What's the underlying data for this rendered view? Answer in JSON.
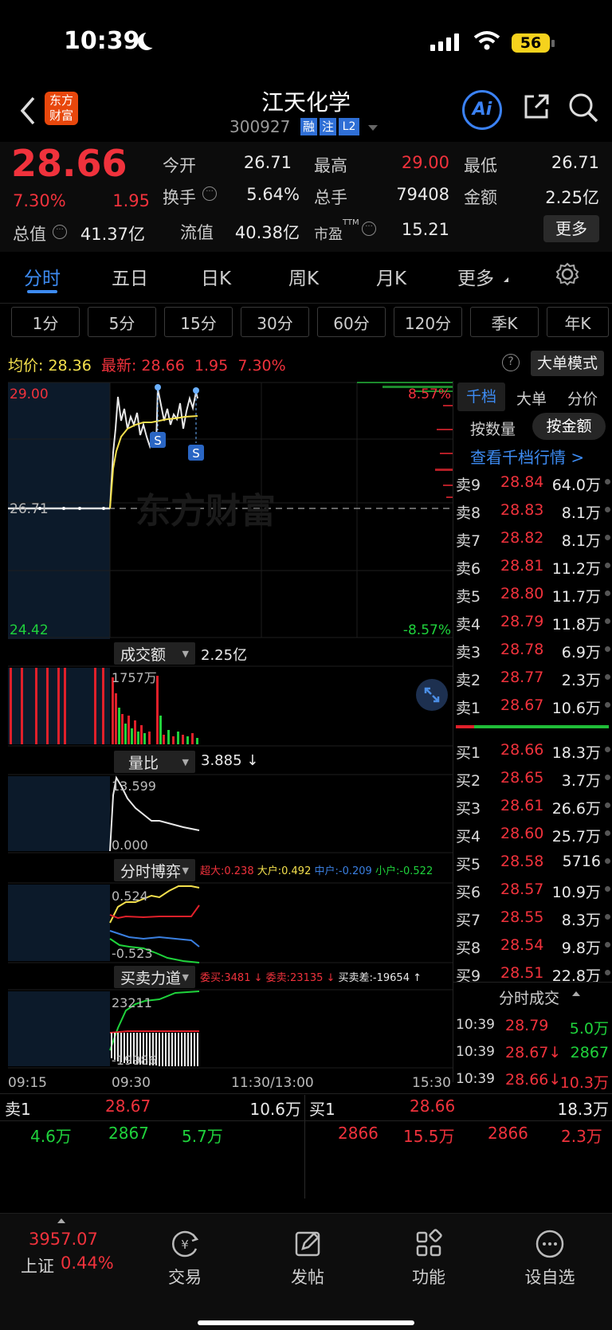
{
  "status": {
    "time": "10:39",
    "battery": "56"
  },
  "header": {
    "logo_top": "东方",
    "logo_bottom": "财富",
    "title": "江天化学",
    "code": "300927",
    "tag_margin": "融",
    "tag_note": "注",
    "tag_l2": "L2",
    "ai": "Ai"
  },
  "quote": {
    "price": "28.66",
    "pct": "7.30%",
    "chg": "1.95",
    "open_label": "今开",
    "open": "26.71",
    "high_label": "最高",
    "high": "29.00",
    "low_label": "最低",
    "low": "26.71",
    "turnover_label": "换手",
    "turnover": "5.64%",
    "vol_label": "总手",
    "vol": "79408",
    "amount_label": "金额",
    "amount": "2.25亿",
    "mcap_label": "总值",
    "mcap": "41.37亿",
    "float_label": "流值",
    "float": "40.38亿",
    "pe_label": "市盈",
    "pe_sup": "TTM",
    "pe": "15.21",
    "more": "更多"
  },
  "tabs": [
    "分时",
    "五日",
    "日K",
    "周K",
    "月K",
    "更多"
  ],
  "periods": [
    "1分",
    "5分",
    "15分",
    "30分",
    "60分",
    "120分",
    "季K",
    "年K"
  ],
  "info": {
    "avg_label": "均价:",
    "avg": "28.36",
    "latest_label": "最新:",
    "latest": "28.66",
    "chg": "1.95",
    "pct": "7.30%",
    "big_mode": "大单模式"
  },
  "chart": {
    "y_top": "29.00",
    "y_mid": "26.71",
    "y_bottom": "24.42",
    "pct_top": "8.57%",
    "pct_bottom": "-8.57%",
    "watermark": "东方财富",
    "signal": "S",
    "amount_label": "成交额",
    "amount_val": "2.25亿",
    "amount_max": "1757万",
    "ratio_label": "量比",
    "ratio_val": "3.885 ↓",
    "ratio_max": "13.599",
    "ratio_min": "0.000",
    "game_label": "分时博弈",
    "game_big": "超大:0.238",
    "game_large": "大户:0.492",
    "game_mid": "中户:-0.209",
    "game_small": "小户:-0.522",
    "game_max": "0.524",
    "game_min": "-0.523",
    "force_label": "买卖力道",
    "force_buy": "委买:3481 ↓",
    "force_sell": "委卖:23135 ↓",
    "force_diff": "买卖差:-19654 ↑",
    "force_max": "23211",
    "force_min": "-19986",
    "times": [
      "09:15",
      "09:30",
      "11:30/13:00",
      "15:30"
    ]
  },
  "book": {
    "tabs": [
      "千档",
      "大单",
      "分价"
    ],
    "by_qty": "按数量",
    "by_amt": "按金额",
    "link": "查看千档行情 >",
    "asks": [
      {
        "label": "卖9",
        "price": "28.84",
        "vol": "64.0万"
      },
      {
        "label": "卖8",
        "price": "28.83",
        "vol": "8.1万"
      },
      {
        "label": "卖7",
        "price": "28.82",
        "vol": "8.1万"
      },
      {
        "label": "卖6",
        "price": "28.81",
        "vol": "11.2万"
      },
      {
        "label": "卖5",
        "price": "28.80",
        "vol": "11.7万"
      },
      {
        "label": "卖4",
        "price": "28.79",
        "vol": "11.8万"
      },
      {
        "label": "卖3",
        "price": "28.78",
        "vol": "6.9万"
      },
      {
        "label": "卖2",
        "price": "28.77",
        "vol": "2.3万"
      },
      {
        "label": "卖1",
        "price": "28.67",
        "vol": "10.6万"
      }
    ],
    "bids": [
      {
        "label": "买1",
        "price": "28.66",
        "vol": "18.3万"
      },
      {
        "label": "买2",
        "price": "28.65",
        "vol": "3.7万"
      },
      {
        "label": "买3",
        "price": "28.61",
        "vol": "26.6万"
      },
      {
        "label": "买4",
        "price": "28.60",
        "vol": "25.7万"
      },
      {
        "label": "买5",
        "price": "28.58",
        "vol": "5716"
      },
      {
        "label": "买6",
        "price": "28.57",
        "vol": "10.9万"
      },
      {
        "label": "买7",
        "price": "28.55",
        "vol": "8.3万"
      },
      {
        "label": "买8",
        "price": "28.54",
        "vol": "9.8万"
      },
      {
        "label": "买9",
        "price": "28.51",
        "vol": "22.8万"
      }
    ],
    "trades_label": "分时成交",
    "trades": [
      {
        "time": "10:39",
        "price": "28.79",
        "vol": "5.0万"
      },
      {
        "time": "10:39",
        "price": "28.67↓",
        "vol": "2867"
      },
      {
        "time": "10:39",
        "price": "28.66↓",
        "vol": "10.3万"
      }
    ]
  },
  "bottom": {
    "sell1_label": "卖1",
    "sell1_price": "28.67",
    "sell1_vol": "10.6万",
    "buy1_label": "买1",
    "buy1_price": "28.66",
    "buy1_vol": "18.3万",
    "left": [
      "4.6万",
      "2867",
      "5.7万"
    ],
    "right": [
      "2866",
      "15.5万",
      "2866",
      "2.3万"
    ]
  },
  "nav": {
    "index": "3957.07",
    "index_name": "上证",
    "index_pct": "0.44%",
    "trade": "交易",
    "post": "发帖",
    "func": "功能",
    "watch": "设自选"
  }
}
